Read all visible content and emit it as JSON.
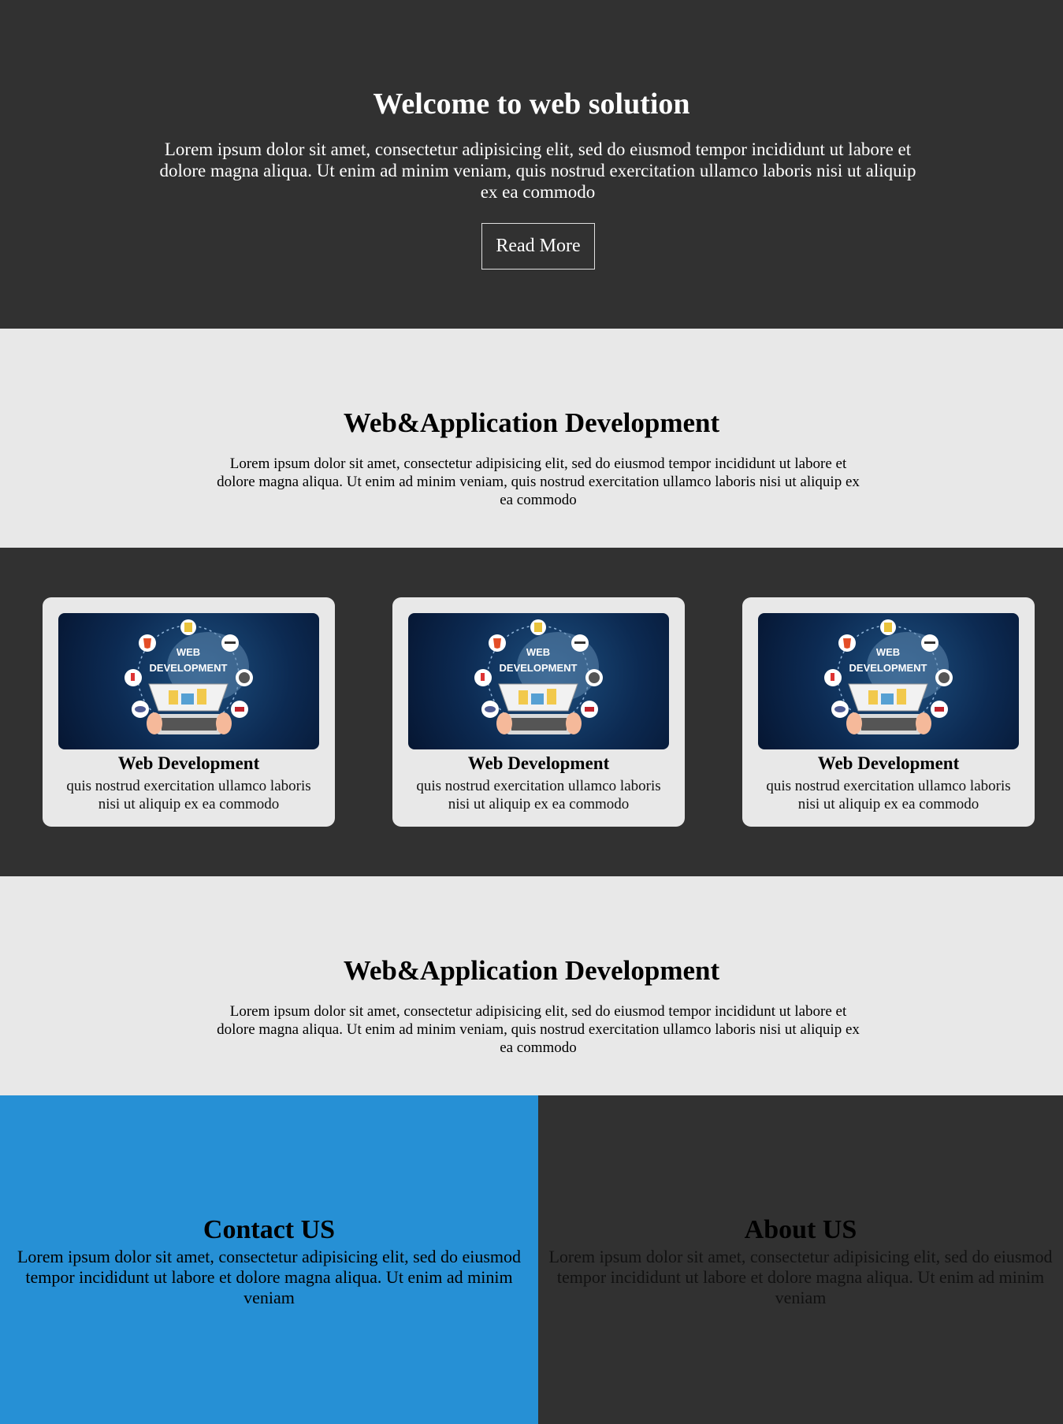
{
  "hero": {
    "title": "Welcome to web solution",
    "text": "Lorem ipsum dolor sit amet, consectetur adipisicing elit, sed do eiusmod tempor incididunt ut labore et dolore magna aliqua. Ut enim ad minim veniam, quis nostrud exercitation ullamco laboris nisi ut aliquip ex ea commodo",
    "button_label": "Read More"
  },
  "section1": {
    "title": "Web&Application Development",
    "text": "Lorem ipsum dolor sit amet, consectetur adipisicing elit, sed do eiusmod tempor incididunt ut labore et dolore magna aliqua. Ut enim ad minim veniam, quis nostrud exercitation ullamco laboris nisi ut aliquip ex ea commodo"
  },
  "cards": [
    {
      "image_label_1": "WEB",
      "image_label_2": "DEVELOPMENT",
      "title": "Web Development",
      "text": "quis nostrud exercitation ullamco laboris nisi ut aliquip ex ea commodo"
    },
    {
      "image_label_1": "WEB",
      "image_label_2": "DEVELOPMENT",
      "title": "Web Development",
      "text": "quis nostrud exercitation ullamco laboris nisi ut aliquip ex ea commodo"
    },
    {
      "image_label_1": "WEB",
      "image_label_2": "DEVELOPMENT",
      "title": "Web Development",
      "text": "quis nostrud exercitation ullamco laboris nisi ut aliquip ex ea commodo"
    }
  ],
  "section2": {
    "title": "Web&Application Development",
    "text": "Lorem ipsum dolor sit amet, consectetur adipisicing elit, sed do eiusmod tempor incididunt ut labore et dolore magna aliqua. Ut enim ad minim veniam, quis nostrud exercitation ullamco laboris nisi ut aliquip ex ea commodo"
  },
  "contact": {
    "title": "Contact US",
    "text": "Lorem ipsum dolor sit amet, consectetur adipisicing elit, sed do eiusmod tempor incididunt ut labore et dolore magna aliqua. Ut enim ad minim veniam"
  },
  "about": {
    "title": "About US",
    "text": "Lorem ipsum dolor sit amet, consectetur adipisicing elit, sed do eiusmod tempor incididunt ut labore et dolore magna aliqua. Ut enim ad minim veniam"
  },
  "colors": {
    "dark_bg": "#313131",
    "light_bg": "#e8e8e8",
    "contact_bg": "#2690d5"
  }
}
